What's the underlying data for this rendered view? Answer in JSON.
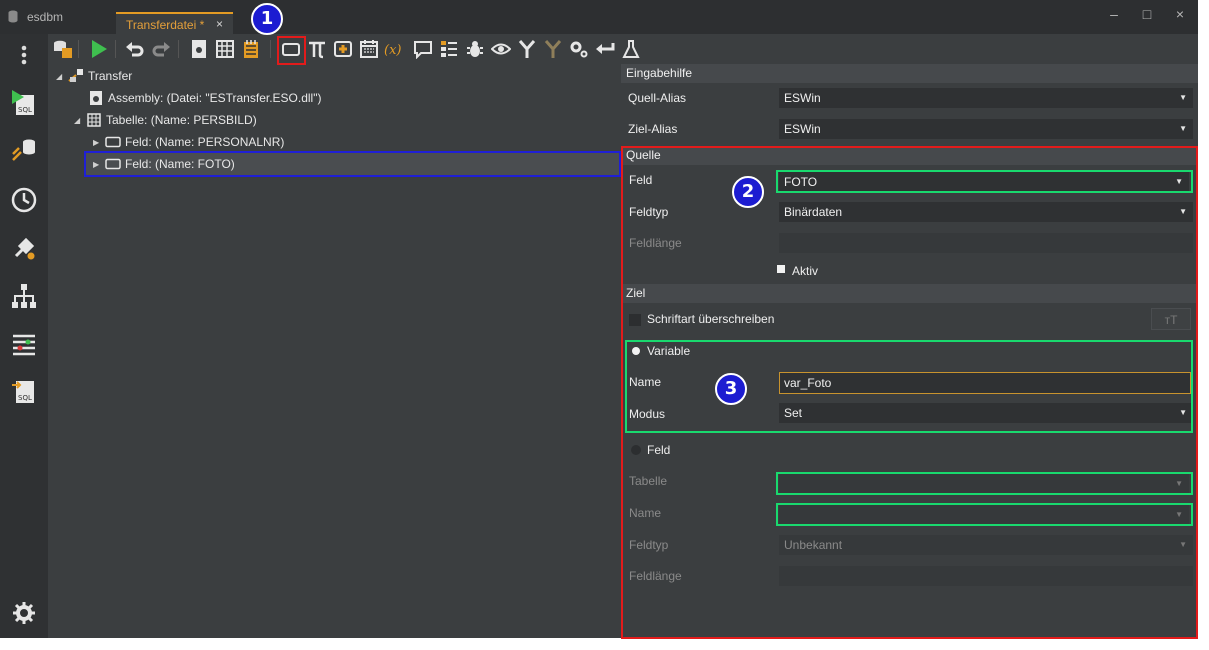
{
  "titlebar": {
    "app_name": "esdbm",
    "tab_label": "Transferdatei *",
    "tab_close": "×",
    "minimize": "–",
    "maximize": "□",
    "close": "×"
  },
  "tree": {
    "items": [
      {
        "label": "Transfer",
        "arrow": "◢"
      },
      {
        "label": "Assembly: (Datei: \"ESTransfer.ESO.dll\")",
        "arrow": ""
      },
      {
        "label": "Tabelle: (Name: PERSBILD)",
        "arrow": "◢"
      },
      {
        "label": "Feld: (Name: PERSONALNR)",
        "arrow": "▶"
      },
      {
        "label": "Feld: (Name: FOTO)",
        "arrow": "▶"
      }
    ]
  },
  "props": {
    "eingabehilfe": {
      "header": "Eingabehilfe",
      "quell_alias_label": "Quell-Alias",
      "quell_alias_value": "ESWin",
      "ziel_alias_label": "Ziel-Alias",
      "ziel_alias_value": "ESWin"
    },
    "quelle": {
      "header": "Quelle",
      "feld_label": "Feld",
      "feld_value": "FOTO",
      "feldtyp_label": "Feldtyp",
      "feldtyp_value": "Binärdaten",
      "feldlaenge_label": "Feldlänge",
      "aktiv_label": "Aktiv"
    },
    "ziel": {
      "header": "Ziel",
      "schriftart_label": "Schriftart überschreiben",
      "font_button": "ᴛT",
      "variable_label": "Variable",
      "name_label": "Name",
      "name_value": "var_Foto",
      "modus_label": "Modus",
      "modus_value": "Set",
      "feld_label": "Feld",
      "tabelle_label": "Tabelle",
      "feld_name_label": "Name",
      "feldtyp_label": "Feldtyp",
      "feldtyp_value": "Unbekannt",
      "feldlaenge_label": "Feldlänge"
    }
  },
  "annotations": {
    "badge_1": "1",
    "badge_2": "2",
    "badge_3": "3"
  },
  "colors": {
    "accent": "#e39b24",
    "annotation_red": "#e31b1b",
    "annotation_green": "#19d96e",
    "annotation_blue": "#1c1cd1",
    "background": "#3b3e40"
  }
}
